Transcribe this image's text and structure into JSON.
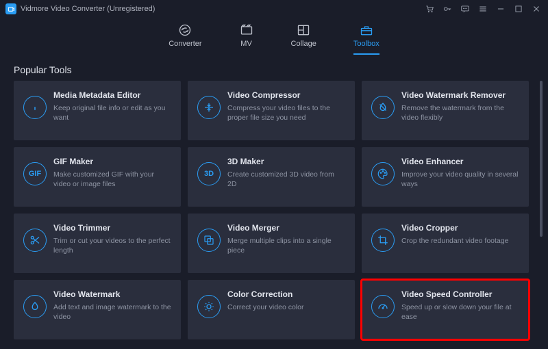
{
  "titlebar": {
    "app_title": "Vidmore Video Converter (Unregistered)"
  },
  "nav": {
    "items": [
      {
        "label": "Converter"
      },
      {
        "label": "MV"
      },
      {
        "label": "Collage"
      },
      {
        "label": "Toolbox"
      }
    ]
  },
  "section_title": "Popular Tools",
  "tools": [
    {
      "title": "Media Metadata Editor",
      "desc": "Keep original file info or edit as you want"
    },
    {
      "title": "Video Compressor",
      "desc": "Compress your video files to the proper file size you need"
    },
    {
      "title": "Video Watermark Remover",
      "desc": "Remove the watermark from the video flexibly"
    },
    {
      "title": "GIF Maker",
      "desc": "Make customized GIF with your video or image files",
      "icon_text": "GIF"
    },
    {
      "title": "3D Maker",
      "desc": "Create customized 3D video from 2D",
      "icon_text": "3D"
    },
    {
      "title": "Video Enhancer",
      "desc": "Improve your video quality in several ways"
    },
    {
      "title": "Video Trimmer",
      "desc": "Trim or cut your videos to the perfect length"
    },
    {
      "title": "Video Merger",
      "desc": "Merge multiple clips into a single piece"
    },
    {
      "title": "Video Cropper",
      "desc": "Crop the redundant video footage"
    },
    {
      "title": "Video Watermark",
      "desc": "Add text and image watermark to the video"
    },
    {
      "title": "Color Correction",
      "desc": "Correct your video color"
    },
    {
      "title": "Video Speed Controller",
      "desc": "Speed up or slow down your file at ease"
    }
  ]
}
